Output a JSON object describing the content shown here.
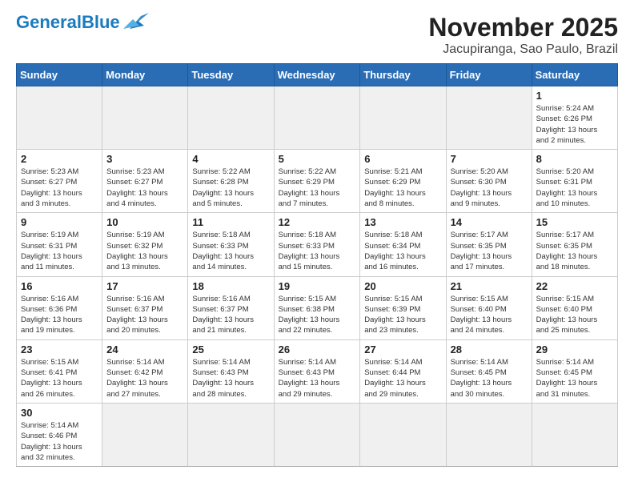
{
  "header": {
    "logo_general": "General",
    "logo_blue": "Blue",
    "month": "November 2025",
    "location": "Jacupiranga, Sao Paulo, Brazil"
  },
  "days_of_week": [
    "Sunday",
    "Monday",
    "Tuesday",
    "Wednesday",
    "Thursday",
    "Friday",
    "Saturday"
  ],
  "weeks": [
    [
      {
        "day": "",
        "info": ""
      },
      {
        "day": "",
        "info": ""
      },
      {
        "day": "",
        "info": ""
      },
      {
        "day": "",
        "info": ""
      },
      {
        "day": "",
        "info": ""
      },
      {
        "day": "",
        "info": ""
      },
      {
        "day": "1",
        "info": "Sunrise: 5:24 AM\nSunset: 6:26 PM\nDaylight: 13 hours\nand 2 minutes."
      }
    ],
    [
      {
        "day": "2",
        "info": "Sunrise: 5:23 AM\nSunset: 6:27 PM\nDaylight: 13 hours\nand 3 minutes."
      },
      {
        "day": "3",
        "info": "Sunrise: 5:23 AM\nSunset: 6:27 PM\nDaylight: 13 hours\nand 4 minutes."
      },
      {
        "day": "4",
        "info": "Sunrise: 5:22 AM\nSunset: 6:28 PM\nDaylight: 13 hours\nand 5 minutes."
      },
      {
        "day": "5",
        "info": "Sunrise: 5:22 AM\nSunset: 6:29 PM\nDaylight: 13 hours\nand 7 minutes."
      },
      {
        "day": "6",
        "info": "Sunrise: 5:21 AM\nSunset: 6:29 PM\nDaylight: 13 hours\nand 8 minutes."
      },
      {
        "day": "7",
        "info": "Sunrise: 5:20 AM\nSunset: 6:30 PM\nDaylight: 13 hours\nand 9 minutes."
      },
      {
        "day": "8",
        "info": "Sunrise: 5:20 AM\nSunset: 6:31 PM\nDaylight: 13 hours\nand 10 minutes."
      }
    ],
    [
      {
        "day": "9",
        "info": "Sunrise: 5:19 AM\nSunset: 6:31 PM\nDaylight: 13 hours\nand 11 minutes."
      },
      {
        "day": "10",
        "info": "Sunrise: 5:19 AM\nSunset: 6:32 PM\nDaylight: 13 hours\nand 13 minutes."
      },
      {
        "day": "11",
        "info": "Sunrise: 5:18 AM\nSunset: 6:33 PM\nDaylight: 13 hours\nand 14 minutes."
      },
      {
        "day": "12",
        "info": "Sunrise: 5:18 AM\nSunset: 6:33 PM\nDaylight: 13 hours\nand 15 minutes."
      },
      {
        "day": "13",
        "info": "Sunrise: 5:18 AM\nSunset: 6:34 PM\nDaylight: 13 hours\nand 16 minutes."
      },
      {
        "day": "14",
        "info": "Sunrise: 5:17 AM\nSunset: 6:35 PM\nDaylight: 13 hours\nand 17 minutes."
      },
      {
        "day": "15",
        "info": "Sunrise: 5:17 AM\nSunset: 6:35 PM\nDaylight: 13 hours\nand 18 minutes."
      }
    ],
    [
      {
        "day": "16",
        "info": "Sunrise: 5:16 AM\nSunset: 6:36 PM\nDaylight: 13 hours\nand 19 minutes."
      },
      {
        "day": "17",
        "info": "Sunrise: 5:16 AM\nSunset: 6:37 PM\nDaylight: 13 hours\nand 20 minutes."
      },
      {
        "day": "18",
        "info": "Sunrise: 5:16 AM\nSunset: 6:37 PM\nDaylight: 13 hours\nand 21 minutes."
      },
      {
        "day": "19",
        "info": "Sunrise: 5:15 AM\nSunset: 6:38 PM\nDaylight: 13 hours\nand 22 minutes."
      },
      {
        "day": "20",
        "info": "Sunrise: 5:15 AM\nSunset: 6:39 PM\nDaylight: 13 hours\nand 23 minutes."
      },
      {
        "day": "21",
        "info": "Sunrise: 5:15 AM\nSunset: 6:40 PM\nDaylight: 13 hours\nand 24 minutes."
      },
      {
        "day": "22",
        "info": "Sunrise: 5:15 AM\nSunset: 6:40 PM\nDaylight: 13 hours\nand 25 minutes."
      }
    ],
    [
      {
        "day": "23",
        "info": "Sunrise: 5:15 AM\nSunset: 6:41 PM\nDaylight: 13 hours\nand 26 minutes."
      },
      {
        "day": "24",
        "info": "Sunrise: 5:14 AM\nSunset: 6:42 PM\nDaylight: 13 hours\nand 27 minutes."
      },
      {
        "day": "25",
        "info": "Sunrise: 5:14 AM\nSunset: 6:43 PM\nDaylight: 13 hours\nand 28 minutes."
      },
      {
        "day": "26",
        "info": "Sunrise: 5:14 AM\nSunset: 6:43 PM\nDaylight: 13 hours\nand 29 minutes."
      },
      {
        "day": "27",
        "info": "Sunrise: 5:14 AM\nSunset: 6:44 PM\nDaylight: 13 hours\nand 29 minutes."
      },
      {
        "day": "28",
        "info": "Sunrise: 5:14 AM\nSunset: 6:45 PM\nDaylight: 13 hours\nand 30 minutes."
      },
      {
        "day": "29",
        "info": "Sunrise: 5:14 AM\nSunset: 6:45 PM\nDaylight: 13 hours\nand 31 minutes."
      }
    ],
    [
      {
        "day": "30",
        "info": "Sunrise: 5:14 AM\nSunset: 6:46 PM\nDaylight: 13 hours\nand 32 minutes."
      },
      {
        "day": "",
        "info": ""
      },
      {
        "day": "",
        "info": ""
      },
      {
        "day": "",
        "info": ""
      },
      {
        "day": "",
        "info": ""
      },
      {
        "day": "",
        "info": ""
      },
      {
        "day": "",
        "info": ""
      }
    ]
  ]
}
